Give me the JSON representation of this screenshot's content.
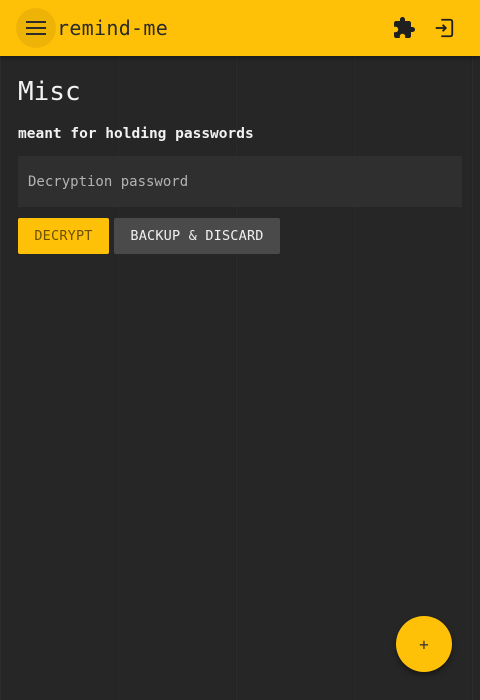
{
  "app": {
    "title": "remind-me",
    "accent_color": "#ffc107",
    "background_color": "#262626"
  },
  "header": {
    "menu_icon": "hamburger-menu-icon",
    "plugin_icon": "puzzle-piece-icon",
    "logout_icon": "logout-icon"
  },
  "page": {
    "title": "Misc",
    "description": "meant for holding passwords"
  },
  "password_field": {
    "placeholder": "Decryption password",
    "value": ""
  },
  "actions": {
    "decrypt_label": "DECRYPT",
    "backup_label": "BACKUP & DISCARD"
  },
  "fab": {
    "label": "+"
  }
}
